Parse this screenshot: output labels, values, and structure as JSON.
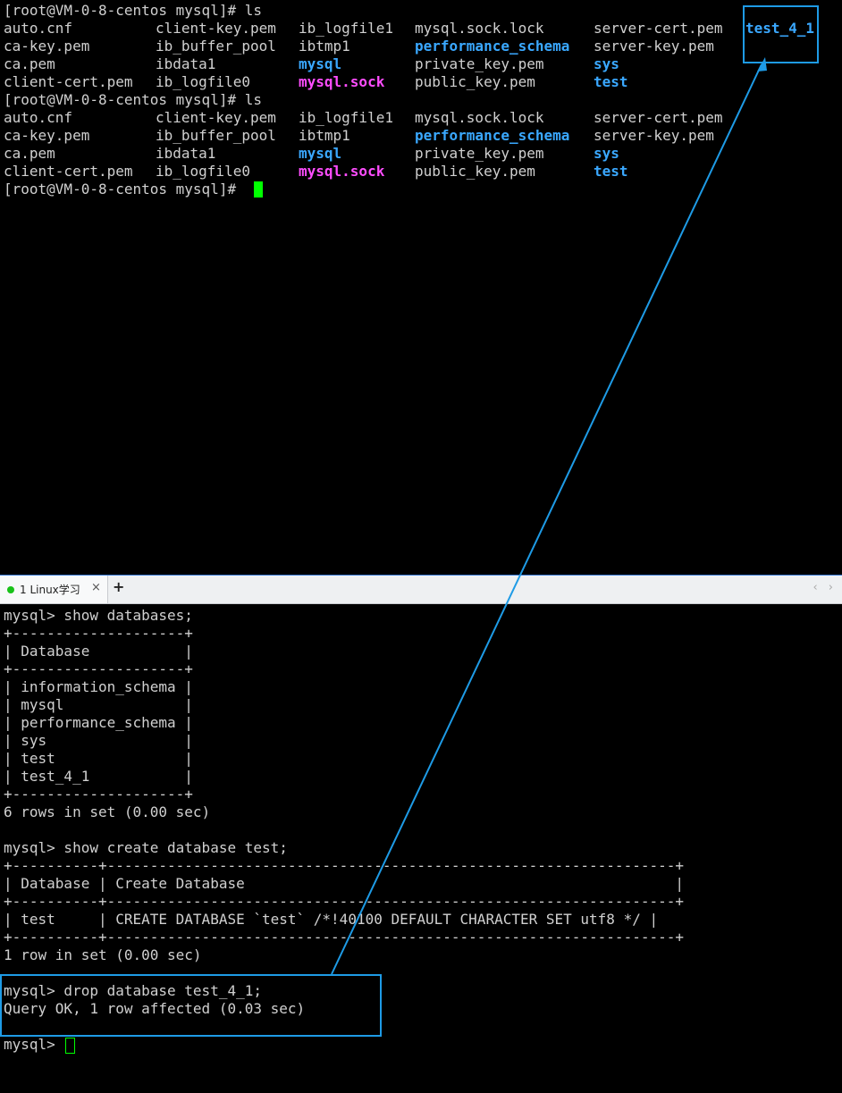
{
  "top_terminal": {
    "prompt1": "[root@VM-0-8-centos mysql]# ls",
    "listing1": [
      [
        {
          "t": "auto.cnf",
          "c": "file"
        },
        {
          "t": "client-key.pem",
          "c": "file"
        },
        {
          "t": "ib_logfile1",
          "c": "file"
        },
        {
          "t": "mysql.sock.lock",
          "c": "file"
        },
        {
          "t": "server-cert.pem",
          "c": "file"
        },
        {
          "t": "test_4_1",
          "c": "dir"
        }
      ],
      [
        {
          "t": "ca-key.pem",
          "c": "file"
        },
        {
          "t": "ib_buffer_pool",
          "c": "file"
        },
        {
          "t": "ibtmp1",
          "c": "file"
        },
        {
          "t": "performance_schema",
          "c": "dir"
        },
        {
          "t": "server-key.pem",
          "c": "file"
        },
        {
          "t": "",
          "c": "file"
        }
      ],
      [
        {
          "t": "ca.pem",
          "c": "file"
        },
        {
          "t": "ibdata1",
          "c": "file"
        },
        {
          "t": "mysql",
          "c": "dir"
        },
        {
          "t": "private_key.pem",
          "c": "file"
        },
        {
          "t": "sys",
          "c": "dir"
        },
        {
          "t": "",
          "c": "file"
        }
      ],
      [
        {
          "t": "client-cert.pem",
          "c": "file"
        },
        {
          "t": "ib_logfile0",
          "c": "file"
        },
        {
          "t": "mysql.sock",
          "c": "sock"
        },
        {
          "t": "public_key.pem",
          "c": "file"
        },
        {
          "t": "test",
          "c": "dir"
        },
        {
          "t": "",
          "c": "file"
        }
      ]
    ],
    "prompt2": "[root@VM-0-8-centos mysql]# ls",
    "listing2": [
      [
        {
          "t": "auto.cnf",
          "c": "file"
        },
        {
          "t": "client-key.pem",
          "c": "file"
        },
        {
          "t": "ib_logfile1",
          "c": "file"
        },
        {
          "t": "mysql.sock.lock",
          "c": "file"
        },
        {
          "t": "server-cert.pem",
          "c": "file"
        }
      ],
      [
        {
          "t": "ca-key.pem",
          "c": "file"
        },
        {
          "t": "ib_buffer_pool",
          "c": "file"
        },
        {
          "t": "ibtmp1",
          "c": "file"
        },
        {
          "t": "performance_schema",
          "c": "dir"
        },
        {
          "t": "server-key.pem",
          "c": "file"
        }
      ],
      [
        {
          "t": "ca.pem",
          "c": "file"
        },
        {
          "t": "ibdata1",
          "c": "file"
        },
        {
          "t": "mysql",
          "c": "dir"
        },
        {
          "t": "private_key.pem",
          "c": "file"
        },
        {
          "t": "sys",
          "c": "dir"
        }
      ],
      [
        {
          "t": "client-cert.pem",
          "c": "file"
        },
        {
          "t": "ib_logfile0",
          "c": "file"
        },
        {
          "t": "mysql.sock",
          "c": "sock"
        },
        {
          "t": "public_key.pem",
          "c": "file"
        },
        {
          "t": "test",
          "c": "dir"
        }
      ]
    ],
    "prompt3": "[root@VM-0-8-centos mysql]# "
  },
  "tabbar": {
    "tab_label": "1 Linux学习",
    "close_glyph": "×",
    "add_glyph": "+",
    "nav_glyphs": "‹ ›"
  },
  "bottom_terminal": {
    "lines": [
      "mysql> show databases;",
      "+--------------------+",
      "| Database           |",
      "+--------------------+",
      "| information_schema |",
      "| mysql              |",
      "| performance_schema |",
      "| sys                |",
      "| test               |",
      "| test_4_1           |",
      "+--------------------+",
      "6 rows in set (0.00 sec)",
      "",
      "mysql> show create database test;",
      "+----------+------------------------------------------------------------------+",
      "| Database | Create Database                                                  |",
      "+----------+------------------------------------------------------------------+",
      "| test     | CREATE DATABASE `test` /*!40100 DEFAULT CHARACTER SET utf8 */ |",
      "+----------+------------------------------------------------------------------+",
      "1 row in set (0.00 sec)",
      "",
      "mysql> drop database test_4_1;",
      "Query OK, 1 row affected (0.03 sec)",
      "",
      "mysql> "
    ]
  },
  "colors": {
    "directory": "#3aa8ff",
    "socket": "#ff4dff",
    "text": "#d0d0d0",
    "cursor": "#00ff00",
    "annotation": "#1e9be6"
  }
}
